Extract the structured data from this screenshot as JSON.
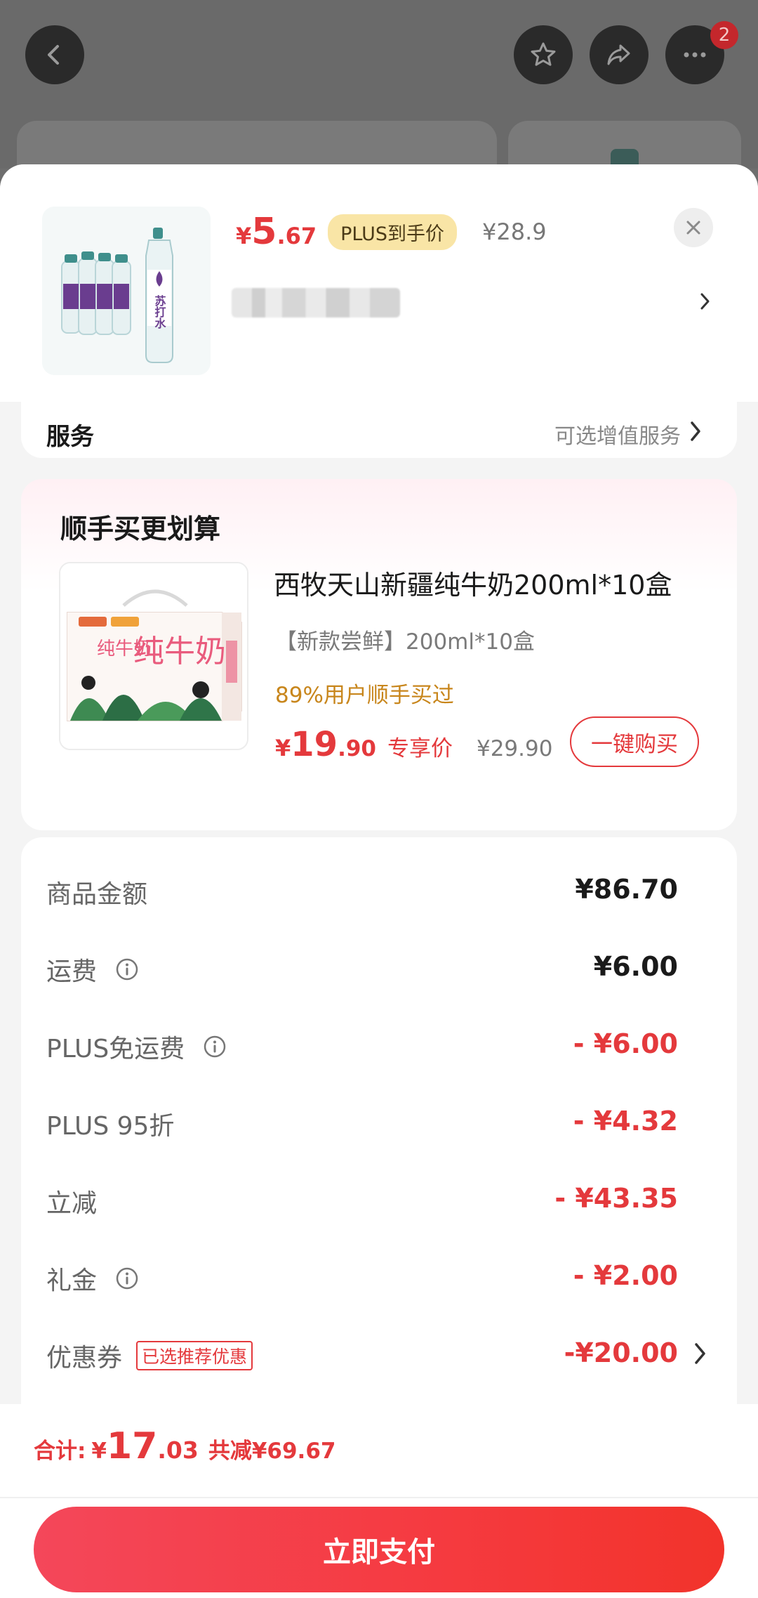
{
  "topbar": {
    "notification_count": "2",
    "icons": [
      "back-icon",
      "star-icon",
      "share-icon",
      "more-icon"
    ]
  },
  "product": {
    "price_currency": "¥",
    "price_int": "5",
    "price_dec": ".67",
    "plus_tag": "PLUS到手价",
    "original_price": "¥28.9",
    "bottle_label": "苏打水"
  },
  "service": {
    "label": "服务",
    "value": "可选增值服务"
  },
  "upsell": {
    "title": "顺手买更划算",
    "image_label": "纯牛奶",
    "name": "西牧天山新疆纯牛奶200ml*10盒",
    "spec": "【新款尝鲜】200ml*10盒",
    "bought": "89%用户顺手买过",
    "price_currency": "¥",
    "price_int": "19",
    "price_dec": ".90",
    "price_label": "专享价",
    "original_price": "¥29.90",
    "buy_label": "一键购买"
  },
  "costs": [
    {
      "label": "商品金额",
      "value": "¥86.70",
      "info": false,
      "red": false
    },
    {
      "label": "运费",
      "value": "¥6.00",
      "info": true,
      "red": false
    },
    {
      "label": "PLUS免运费",
      "value": "- ¥6.00",
      "info": true,
      "red": true
    },
    {
      "label": "PLUS 95折",
      "value": "- ¥4.32",
      "info": false,
      "red": true
    },
    {
      "label": "立减",
      "value": "- ¥43.35",
      "info": false,
      "red": true
    },
    {
      "label": "礼金",
      "value": "- ¥2.00",
      "info": true,
      "red": true
    },
    {
      "label": "优惠券",
      "value": "-¥20.00",
      "info": false,
      "red": true,
      "badge": "已选推荐优惠"
    }
  ],
  "total": {
    "label": "合计:",
    "currency": "¥",
    "int": "17",
    "dec": ".03",
    "saved": "共减¥69.67"
  },
  "pay_button": "立即支付",
  "colors": {
    "accent": "#e4393c",
    "plus_tag_bg": "#f9e5a6",
    "bought_text": "#c8861c"
  }
}
